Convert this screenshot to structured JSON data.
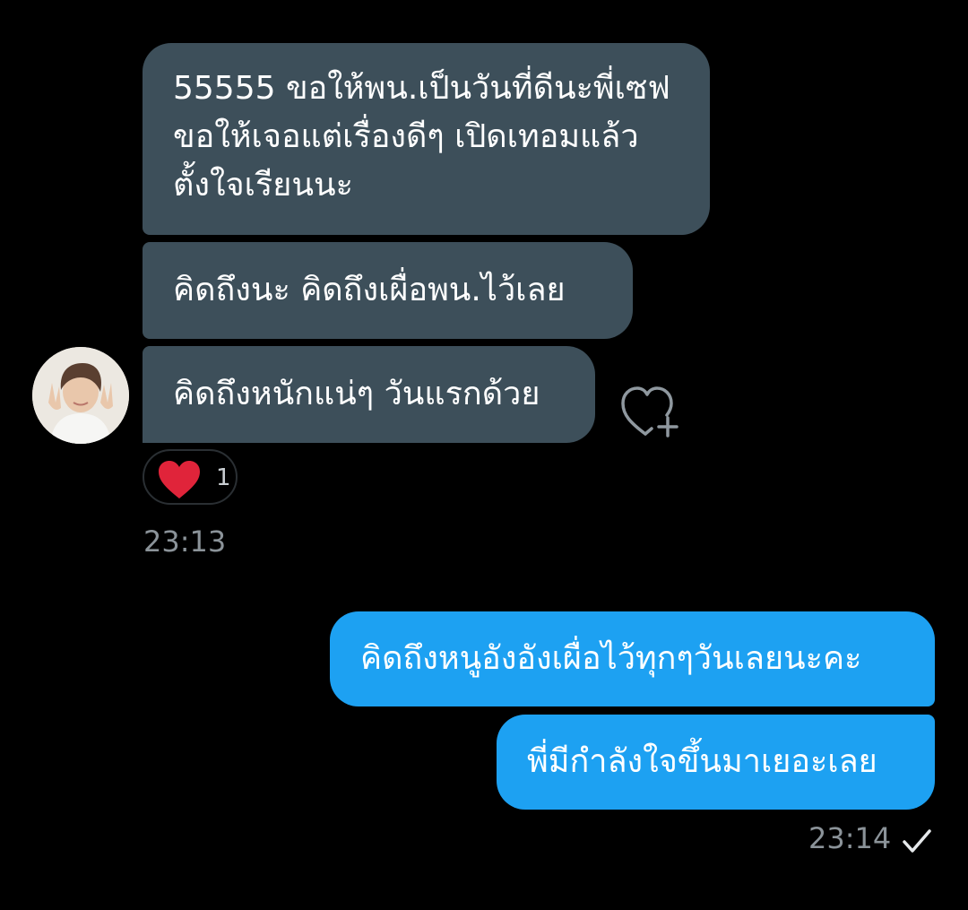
{
  "received": [
    {
      "text": "55555 ขอให้พน.เป็นวันที่ดีนะพี่เซฟ ขอให้เจอแต่เรื่องดีๆ เปิดเทอมแล้ว ตั้งใจเรียนนะ"
    },
    {
      "text": "คิดถึงนะ คิดถึงเผื่อพน.ไว้เลย"
    },
    {
      "text": "คิดถึงหนักแน่ๆ วันแรกด้วย"
    }
  ],
  "reaction": {
    "icon": "heart-icon",
    "count": "1",
    "color": "#e0243a"
  },
  "received_time": "23:13",
  "sent": [
    {
      "text": "คิดถึงหนูอังอังเผื่อไว้ทุกๆวันเลยนะคะ"
    },
    {
      "text": "พี่มีกำลังใจขึ้นมาเยอะเลย"
    }
  ],
  "sent_time": "23:14",
  "colors": {
    "background": "#000000",
    "received_bubble": "#3d4f5a",
    "sent_bubble": "#1da1f2",
    "timestamp": "#8b9399"
  }
}
